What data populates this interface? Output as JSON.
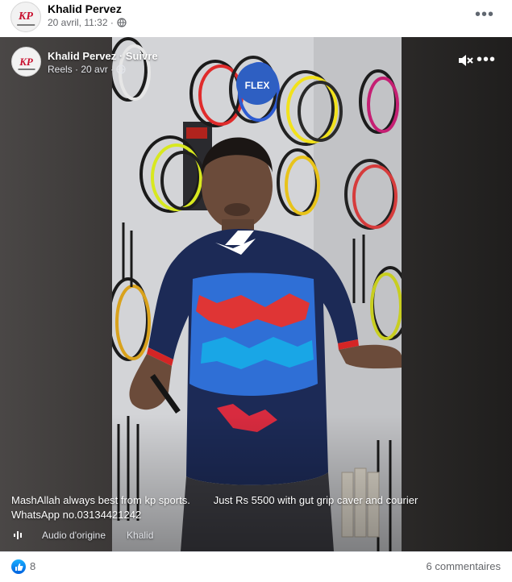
{
  "post": {
    "author": "Khalid Pervez",
    "date": "20 avril, 11:32 ·",
    "avatar_logo": "KP",
    "menu_icon": "more-dots-icon"
  },
  "reel": {
    "author_follow": "Khalid Pervez · Suivre",
    "meta": "Reels · 20 avr ·",
    "privacy_icon": "globe-icon",
    "mute_icon": "speaker-muted-icon",
    "menu_icon": "more-dots-icon",
    "caption": "MashAllah always best from kp sports.        Just Rs 5500 with gut grip caver and courier\nWhatsApp no.03134421242",
    "audio": {
      "icon": "audio-wave-icon",
      "label": "Audio d'origine",
      "artist": "Khalid"
    }
  },
  "footer": {
    "reaction_icon": "thumbs-up-icon",
    "reaction_count": "8",
    "comments": "6 commentaires"
  },
  "colors": {
    "like_blue": "#0866ff",
    "text_primary": "#050505",
    "text_secondary": "#65676b",
    "logo_red": "#c8102e"
  }
}
